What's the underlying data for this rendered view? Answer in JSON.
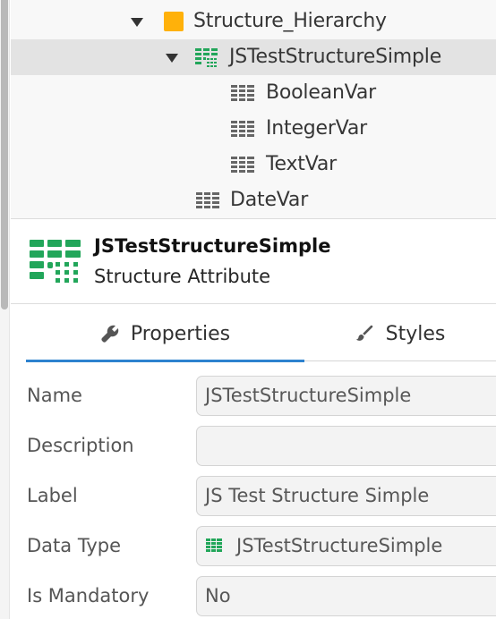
{
  "tree": {
    "items": [
      {
        "label": "Structure_Hierarchy",
        "icon": "folder-icon"
      },
      {
        "label": "JSTestStructureSimple",
        "icon": "structure-icon"
      },
      {
        "label": "BooleanVar",
        "icon": "structure-attribute-icon"
      },
      {
        "label": "IntegerVar",
        "icon": "structure-attribute-icon"
      },
      {
        "label": "TextVar",
        "icon": "structure-attribute-icon"
      },
      {
        "label": "DateVar",
        "icon": "structure-attribute-icon"
      }
    ]
  },
  "details": {
    "title": "JSTestStructureSimple",
    "subtitle": "Structure Attribute",
    "icon": "structure-icon"
  },
  "tabs": [
    {
      "label": "Properties",
      "icon": "wrench-icon",
      "active": true
    },
    {
      "label": "Styles",
      "icon": "paintbrush-icon",
      "active": false
    }
  ],
  "properties": [
    {
      "label": "Name",
      "value": "JSTestStructureSimple"
    },
    {
      "label": "Description",
      "value": ""
    },
    {
      "label": "Label",
      "value": "JS Test Structure Simple"
    },
    {
      "label": "Data Type",
      "value": "JSTestStructureSimple",
      "icon": "structure-icon"
    },
    {
      "label": "Is Mandatory",
      "value": "No"
    }
  ],
  "colors": {
    "accent": "#2d82cf",
    "folder": "#ffb10a",
    "structure": "#22a65a",
    "attribute": "#666666",
    "selected_row": "#e3e3e3"
  }
}
